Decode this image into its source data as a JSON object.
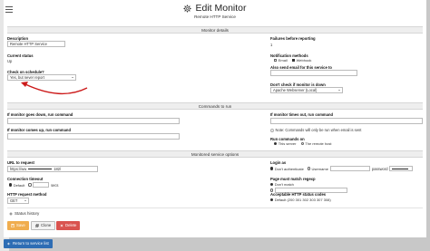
{
  "page": {
    "title": "Edit Monitor",
    "subtitle": "Remote HTTP Service"
  },
  "sections": {
    "monitor_details": "Monitor details",
    "commands": "Commands to run",
    "service_options": "Monitored service options"
  },
  "details": {
    "description_label": "Description",
    "description_value": "Remote HTTP Service",
    "failures_label": "Failures before reporting",
    "failures_value": "1",
    "current_status_label": "Current status",
    "current_status_value": "Up",
    "notification_label": "Notification methods",
    "notification_options": [
      "Email",
      "Webhook"
    ],
    "email_label": "Also send email for this service to",
    "check_schedule_label": "Check on schedule?",
    "check_schedule_value": "Yes, but never report",
    "dont_check_label": "Don't check if monitor is down",
    "dont_check_value": "Apache Webserver (Local)"
  },
  "commands": {
    "down_label": "If monitor goes down, run command",
    "timeout_label": "If monitor times out, run command",
    "up_label": "If monitor comes up, run command",
    "note": "Note: Commands will only be run when email is sent",
    "run_on_label": "Run commands on",
    "run_on_options": [
      "This server",
      "The remote host"
    ]
  },
  "service": {
    "url_label": "URL to request",
    "url_value_start": "https://ww",
    "url_value_end": "182/",
    "login_label": "Login as",
    "login_options": [
      "Don't authenticate",
      "Username"
    ],
    "password_label": "password",
    "timeout_label": "Connection timeout",
    "timeout_options": [
      "Default",
      "secs"
    ],
    "regexp_label": "Page must match regexp",
    "regexp_options": [
      "Don't match"
    ],
    "method_label": "HTTP request method",
    "method_value": "GET",
    "status_codes_label": "Acceptable HTTP status codes",
    "status_codes_value": "Default (200 301 302 303 307 308)"
  },
  "status_history_label": "Status history",
  "buttons": {
    "save": "Save",
    "clone": "Clone",
    "delete": "Delete",
    "return": "Return to service list"
  },
  "colors": {
    "save": "#f0ad4e",
    "delete": "#d9534f",
    "return": "#2e6db4",
    "annotation_arrow": "#cc1a1a"
  },
  "icons": [
    "hamburger-menu-icon",
    "gear-icon",
    "save-icon",
    "clone-icon",
    "delete-icon",
    "arrow-left-icon",
    "plus-icon"
  ]
}
